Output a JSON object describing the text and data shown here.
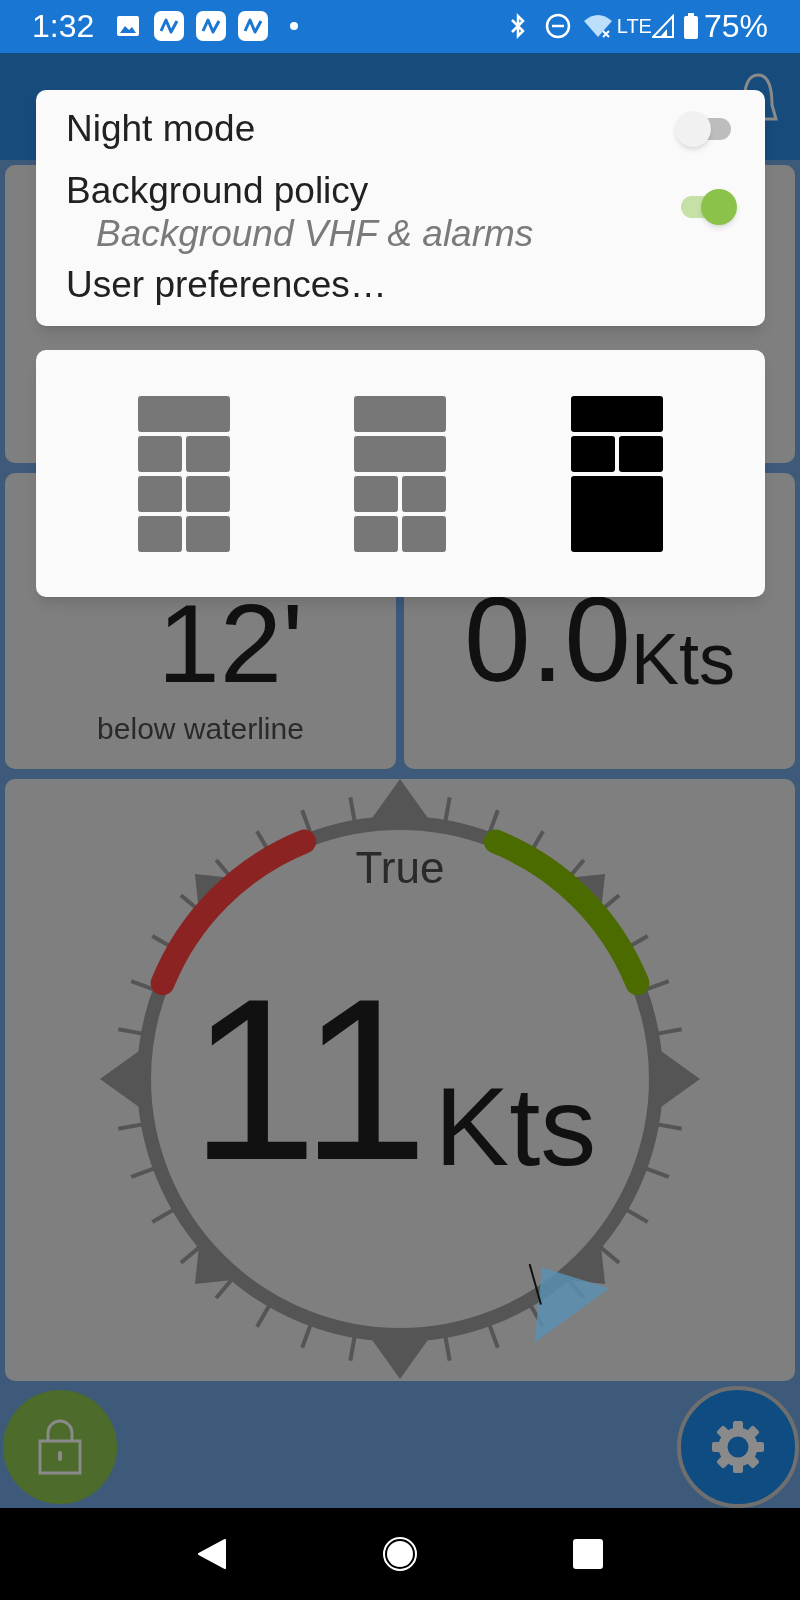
{
  "status_bar": {
    "time": "1:32",
    "network": "LTE",
    "battery": "75%"
  },
  "menu": {
    "items": [
      {
        "kind": "toggle",
        "label": "Night mode",
        "on": false
      },
      {
        "kind": "toggle",
        "label": "Background policy",
        "subtitle": "Background VHF & alarms",
        "on": true
      },
      {
        "kind": "action",
        "label": "User preferences…"
      }
    ]
  },
  "layouts": [
    {
      "kind": "grid-8",
      "selected": false
    },
    {
      "kind": "grid-6",
      "selected": false
    },
    {
      "kind": "grid-3",
      "selected": true
    }
  ],
  "depth_card": {
    "value": "12'",
    "caption": "below waterline"
  },
  "speed_card": {
    "value": "0.0",
    "unit": "Kts"
  },
  "wind_gauge": {
    "label": "True",
    "value": "11",
    "unit": "Kts"
  }
}
